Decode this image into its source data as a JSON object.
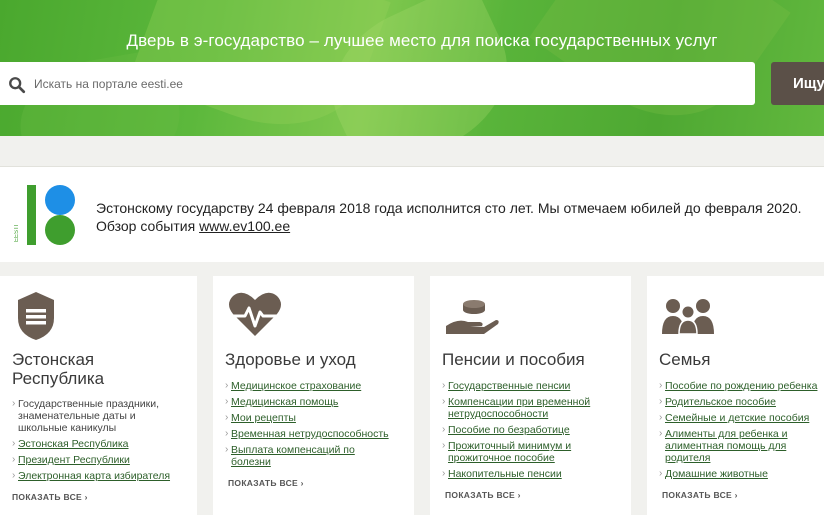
{
  "hero": {
    "title": "Дверь в э-государство – лучшее место для поиска государственных услуг",
    "search_placeholder": "Искать на портале eesti.ee",
    "search_button": "Ищу"
  },
  "banner": {
    "logo_text": "EESTI",
    "line1": "Эстонскому государству 24 февраля 2018 года исполнится сто лет. Мы отмечаем юбилей до февраля 2020.",
    "line2_prefix": "Обзор события ",
    "link": "www.ev100.ee"
  },
  "cards": [
    {
      "icon": "shield-icon",
      "title": "Эстонская Республика",
      "items": [
        {
          "text": "Государственные праздники, знаменательные даты и школьные каникулы",
          "link": false
        },
        {
          "text": "Эстонская Республика",
          "link": true
        },
        {
          "text": "Президент Республики",
          "link": true
        },
        {
          "text": "Электронная карта избирателя",
          "link": true
        }
      ],
      "show_all": "ПОКАЗАТЬ ВСЕ ›"
    },
    {
      "icon": "heart-pulse-icon",
      "title": "Здоровье и уход",
      "items": [
        {
          "text": "Медицинское страхование",
          "link": true
        },
        {
          "text": "Медицинская помощь",
          "link": true
        },
        {
          "text": "Мои рецепты",
          "link": true
        },
        {
          "text": "Временная нетрудоспособность",
          "link": true
        },
        {
          "text": "Выплата компенсаций по болезни",
          "link": true
        }
      ],
      "show_all": "ПОКАЗАТЬ ВСЕ ›"
    },
    {
      "icon": "hand-coins-icon",
      "title": "Пенсии и пособия",
      "items": [
        {
          "text": "Государственные пенсии",
          "link": true
        },
        {
          "text": "Компенсации при временной нетрудоспособности",
          "link": true
        },
        {
          "text": "Пособие по безработице",
          "link": true
        },
        {
          "text": "Прожиточный минимум и прожиточное пособие",
          "link": true
        },
        {
          "text": "Накопительные пенсии",
          "link": true
        }
      ],
      "show_all": "ПОКАЗАТЬ ВСЕ ›"
    },
    {
      "icon": "family-icon",
      "title": "Семья",
      "items": [
        {
          "text": "Пособие по рождению ребенка",
          "link": true
        },
        {
          "text": "Родительское пособие",
          "link": true
        },
        {
          "text": "Семейные и детские пособия",
          "link": true
        },
        {
          "text": "Алименты для ребенка и алиментная помощь для родителя",
          "link": true
        },
        {
          "text": "Домашние животные",
          "link": true
        }
      ],
      "show_all": "ПОКАЗАТЬ ВСЕ ›"
    }
  ],
  "colors": {
    "hero_green": "#4ea832",
    "button_brown": "#5b5048",
    "icon_brown": "#6b5d52",
    "link_green": "#2d5f2a",
    "logo_blue": "#1e8fe6",
    "logo_green": "#3f9e2e"
  }
}
